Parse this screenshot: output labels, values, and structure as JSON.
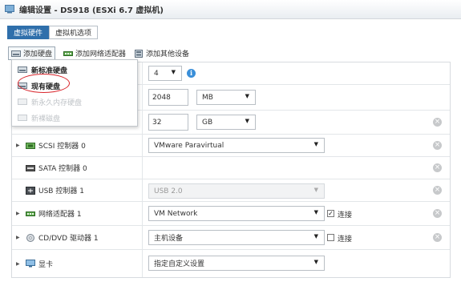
{
  "window": {
    "title": "编辑设置 - DS918 (ESXi 6.7 虚拟机)"
  },
  "tabs": [
    {
      "label": "虚拟硬件",
      "active": true
    },
    {
      "label": "虚拟机选项",
      "active": false
    }
  ],
  "toolbar": {
    "add_disk": "添加硬盘",
    "add_network": "添加网络适配器",
    "add_other": "添加其他设备"
  },
  "add_disk_menu": {
    "items": [
      {
        "label": "新标准硬盘",
        "enabled": true
      },
      {
        "label": "现有硬盘",
        "enabled": true
      },
      {
        "label": "新永久内存硬盘",
        "enabled": false
      },
      {
        "label": "新裸磁盘",
        "enabled": false
      }
    ]
  },
  "devices": {
    "cpu": {
      "value": "4"
    },
    "memory": {
      "value": "2048",
      "unit": "MB"
    },
    "hard_disk": {
      "value": "32",
      "unit": "GB"
    },
    "scsi": {
      "label": "SCSI 控制器 0",
      "value": "VMware Paravirtual"
    },
    "sata": {
      "label": "SATA 控制器 0"
    },
    "usb": {
      "label": "USB 控制器 1",
      "value": "USB 2.0"
    },
    "network": {
      "label": "网络适配器 1",
      "value": "VM Network",
      "connect_label": "连接",
      "connected": true
    },
    "cdrom": {
      "label": "CD/DVD 驱动器 1",
      "value": "主机设备",
      "connect_label": "连接",
      "connected": false
    },
    "video": {
      "label": "显卡",
      "value": "指定自定义设置"
    }
  },
  "colors": {
    "accent": "#2f6fab",
    "highlight_circle": "#d9252b",
    "info": "#3a8fd9"
  }
}
